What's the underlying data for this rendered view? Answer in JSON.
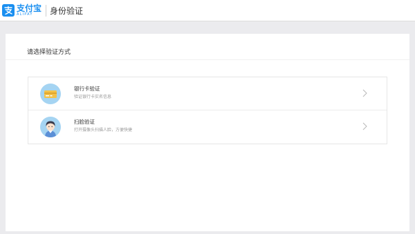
{
  "header": {
    "logo_cn": "支付宝",
    "logo_en": "ALIPAY",
    "title": "身份验证"
  },
  "card": {
    "title": "请选择验证方式"
  },
  "options": [
    {
      "icon": "bank-card-icon",
      "title": "银行卡验证",
      "desc": "验证银行卡实名信息"
    },
    {
      "icon": "face-scan-icon",
      "title": "扫脸验证",
      "desc": "打开摄像头扫描人脸，方便快捷"
    }
  ],
  "colors": {
    "brand": "#1a8ff0",
    "background": "#ebebee",
    "icon_bg": "#a5d4f2"
  }
}
